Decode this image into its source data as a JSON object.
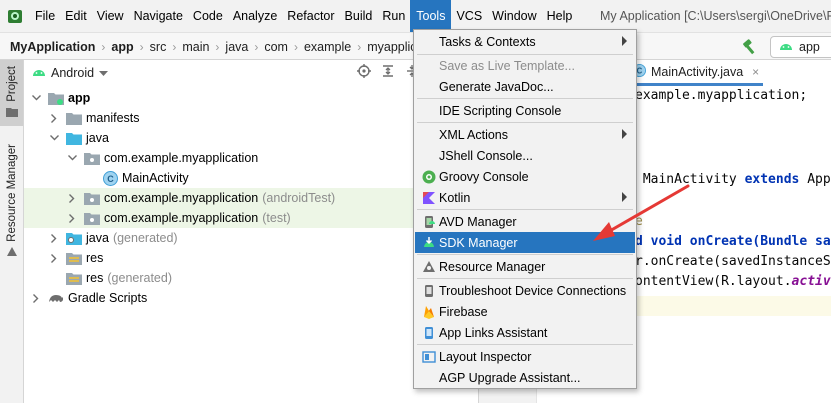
{
  "menu": {
    "items": [
      "File",
      "Edit",
      "View",
      "Navigate",
      "Code",
      "Analyze",
      "Refactor",
      "Build",
      "Run",
      "Tools",
      "VCS",
      "Window",
      "Help"
    ],
    "active": "Tools",
    "window_title": "My Application [C:\\Users\\sergi\\OneDrive\\Pri"
  },
  "breadcrumb": [
    "MyApplication",
    "app",
    "src",
    "main",
    "java",
    "com",
    "example",
    "myapplica"
  ],
  "run_config": {
    "label": "app"
  },
  "tool_strip": {
    "project_tab": "Project",
    "resource_tab": "Resource Manager"
  },
  "project_panel": {
    "view_mode": "Android",
    "tree": [
      {
        "label": "app",
        "suffix": "",
        "icon": "module-folder-icon",
        "bold": true
      },
      {
        "label": "manifests",
        "suffix": "",
        "icon": "folder-icon"
      },
      {
        "label": "java",
        "suffix": "",
        "icon": "folder-icon"
      },
      {
        "label": "com.example.myapplication",
        "suffix": "",
        "icon": "package-icon"
      },
      {
        "label": "MainActivity",
        "suffix": "",
        "icon": "class-icon"
      },
      {
        "label": "com.example.myapplication",
        "suffix": "(androidTest)",
        "icon": "package-icon"
      },
      {
        "label": "com.example.myapplication",
        "suffix": "(test)",
        "icon": "package-icon"
      },
      {
        "label": "java",
        "suffix": "(generated)",
        "icon": "generated-folder-icon"
      },
      {
        "label": "res",
        "suffix": "",
        "icon": "res-folder-icon"
      },
      {
        "label": "res",
        "suffix": "(generated)",
        "icon": "res-folder-icon"
      },
      {
        "label": "Gradle Scripts",
        "suffix": "",
        "icon": "gradle-icon"
      }
    ]
  },
  "editor": {
    "tab_label": "MainActivity.java",
    "code_lines": [
      "example.myapplication;",
      "",
      "",
      "",
      " MainActivity ",
      "extends",
      " App",
      "e",
      "d void onCreate(Bundle sa",
      "r.onCreate(savedInstanceS",
      "ontentView(R.layout.",
      "activ"
    ]
  },
  "tools_menu": {
    "items": [
      {
        "label": "Tasks & Contexts",
        "has_submenu": true,
        "icon": ""
      },
      {
        "label": "Save as Live Template...",
        "disabled": true,
        "icon": ""
      },
      {
        "label": "Generate JavaDoc...",
        "icon": ""
      },
      {
        "label": "IDE Scripting Console",
        "icon": ""
      },
      {
        "label": "XML Actions",
        "has_submenu": true,
        "icon": ""
      },
      {
        "label": "JShell Console...",
        "icon": ""
      },
      {
        "label": "Groovy Console",
        "icon": "groovy-icon"
      },
      {
        "label": "Kotlin",
        "has_submenu": true,
        "icon": "kotlin-icon"
      },
      {
        "label": "AVD Manager",
        "icon": "avd-manager-icon"
      },
      {
        "label": "SDK Manager",
        "selected": true,
        "icon": "sdk-manager-icon"
      },
      {
        "label": "Resource Manager",
        "icon": "resource-manager-icon"
      },
      {
        "label": "Troubleshoot Device Connections",
        "icon": "troubleshoot-icon"
      },
      {
        "label": "Firebase",
        "icon": "firebase-icon"
      },
      {
        "label": "App Links Assistant",
        "icon": "app-links-icon"
      },
      {
        "label": "Layout Inspector",
        "icon": "layout-inspector-icon"
      },
      {
        "label": "AGP Upgrade Assistant...",
        "icon": ""
      }
    ]
  },
  "colors": {
    "selection": "#2675bf",
    "annotation_arrow": "#e53935",
    "highlight_row": "#edf6e6",
    "android_green": "#3ddc84"
  }
}
